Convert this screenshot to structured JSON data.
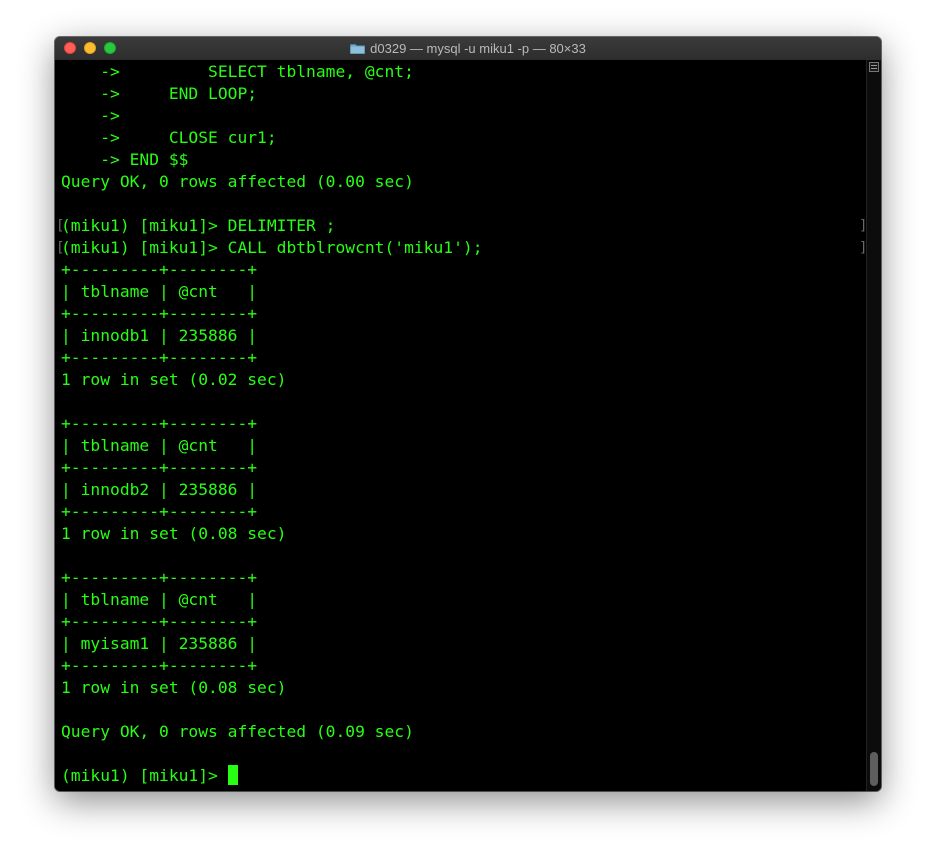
{
  "window": {
    "title": "d0329 — mysql -u miku1 -p — 80×33"
  },
  "terminal": {
    "lines": [
      "    ->         SELECT tblname, @cnt;",
      "    ->     END LOOP;",
      "    ->",
      "    ->     CLOSE cur1;",
      "    -> END $$",
      "Query OK, 0 rows affected (0.00 sec)",
      "",
      "(miku1) [miku1]> DELIMITER ;",
      "(miku1) [miku1]> CALL dbtblrowcnt('miku1');",
      "+---------+--------+",
      "| tblname | @cnt   |",
      "+---------+--------+",
      "| innodb1 | 235886 |",
      "+---------+--------+",
      "1 row in set (0.02 sec)",
      "",
      "+---------+--------+",
      "| tblname | @cnt   |",
      "+---------+--------+",
      "| innodb2 | 235886 |",
      "+---------+--------+",
      "1 row in set (0.08 sec)",
      "",
      "+---------+--------+",
      "| tblname | @cnt   |",
      "+---------+--------+",
      "| myisam1 | 235886 |",
      "+---------+--------+",
      "1 row in set (0.08 sec)",
      "",
      "Query OK, 0 rows affected (0.09 sec)",
      "",
      "(miku1) [miku1]> "
    ],
    "prompt_line_index": 32
  },
  "colors": {
    "text": "#28fe14",
    "background": "#000000"
  },
  "icons": {
    "title": "folder-icon",
    "scrollbar": "split-pane-icon"
  }
}
